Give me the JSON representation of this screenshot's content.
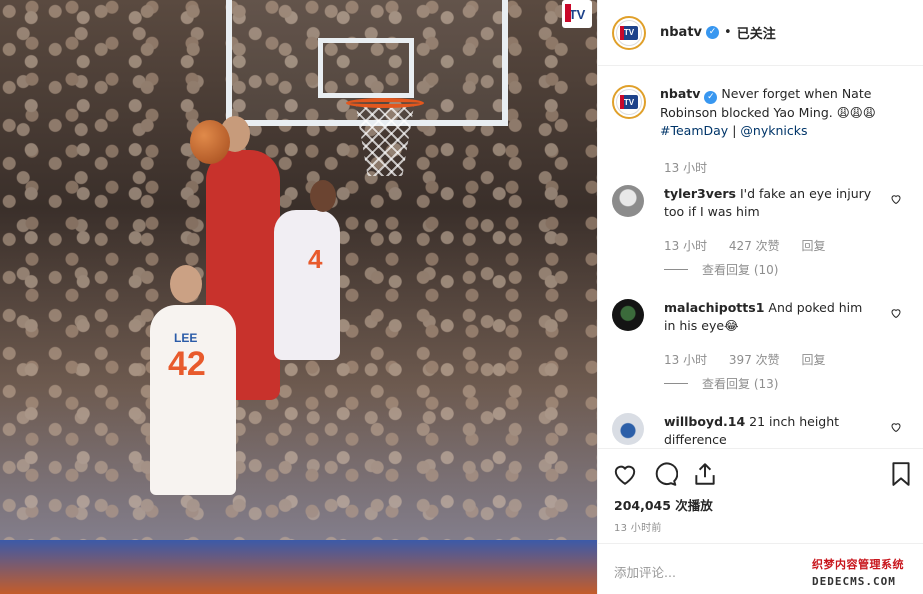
{
  "media": {
    "player_name": "LEE",
    "player_number": "42",
    "other_number": "4"
  },
  "header": {
    "username": "nbatv",
    "dot": "•",
    "follow_state": "已关注"
  },
  "caption": {
    "username": "nbatv",
    "text": "Never forget when Nate Robinson blocked Yao Ming. 😩😩😩",
    "hashtag": "#TeamDay",
    "separator": "|",
    "mention": "@nyknicks",
    "time": "13 小时"
  },
  "comments": [
    {
      "username": "tyler3vers",
      "text": "I'd fake an eye injury too if I was him",
      "time": "13 小时",
      "likes": "427 次赞",
      "reply": "回复",
      "view_replies": "查看回复 (10)"
    },
    {
      "username": "malachipotts1",
      "text": "And poked him in his eye😂",
      "time": "13 小时",
      "likes": "397 次赞",
      "reply": "回复",
      "view_replies": "查看回复 (13)"
    },
    {
      "username": "willboyd.14",
      "text": "21 inch height difference",
      "time": "",
      "likes": "",
      "reply": "",
      "view_replies": ""
    }
  ],
  "stats": {
    "views": "204,045 次播放",
    "posted": "13 小时前"
  },
  "add_comment": {
    "placeholder": "添加评论..."
  },
  "watermark": {
    "line1": "织梦内容管理系统",
    "line2": "DEDECMS.COM"
  },
  "colors": {
    "verified": "#3897f0",
    "link": "#003569",
    "muted": "#8e8e8e"
  }
}
